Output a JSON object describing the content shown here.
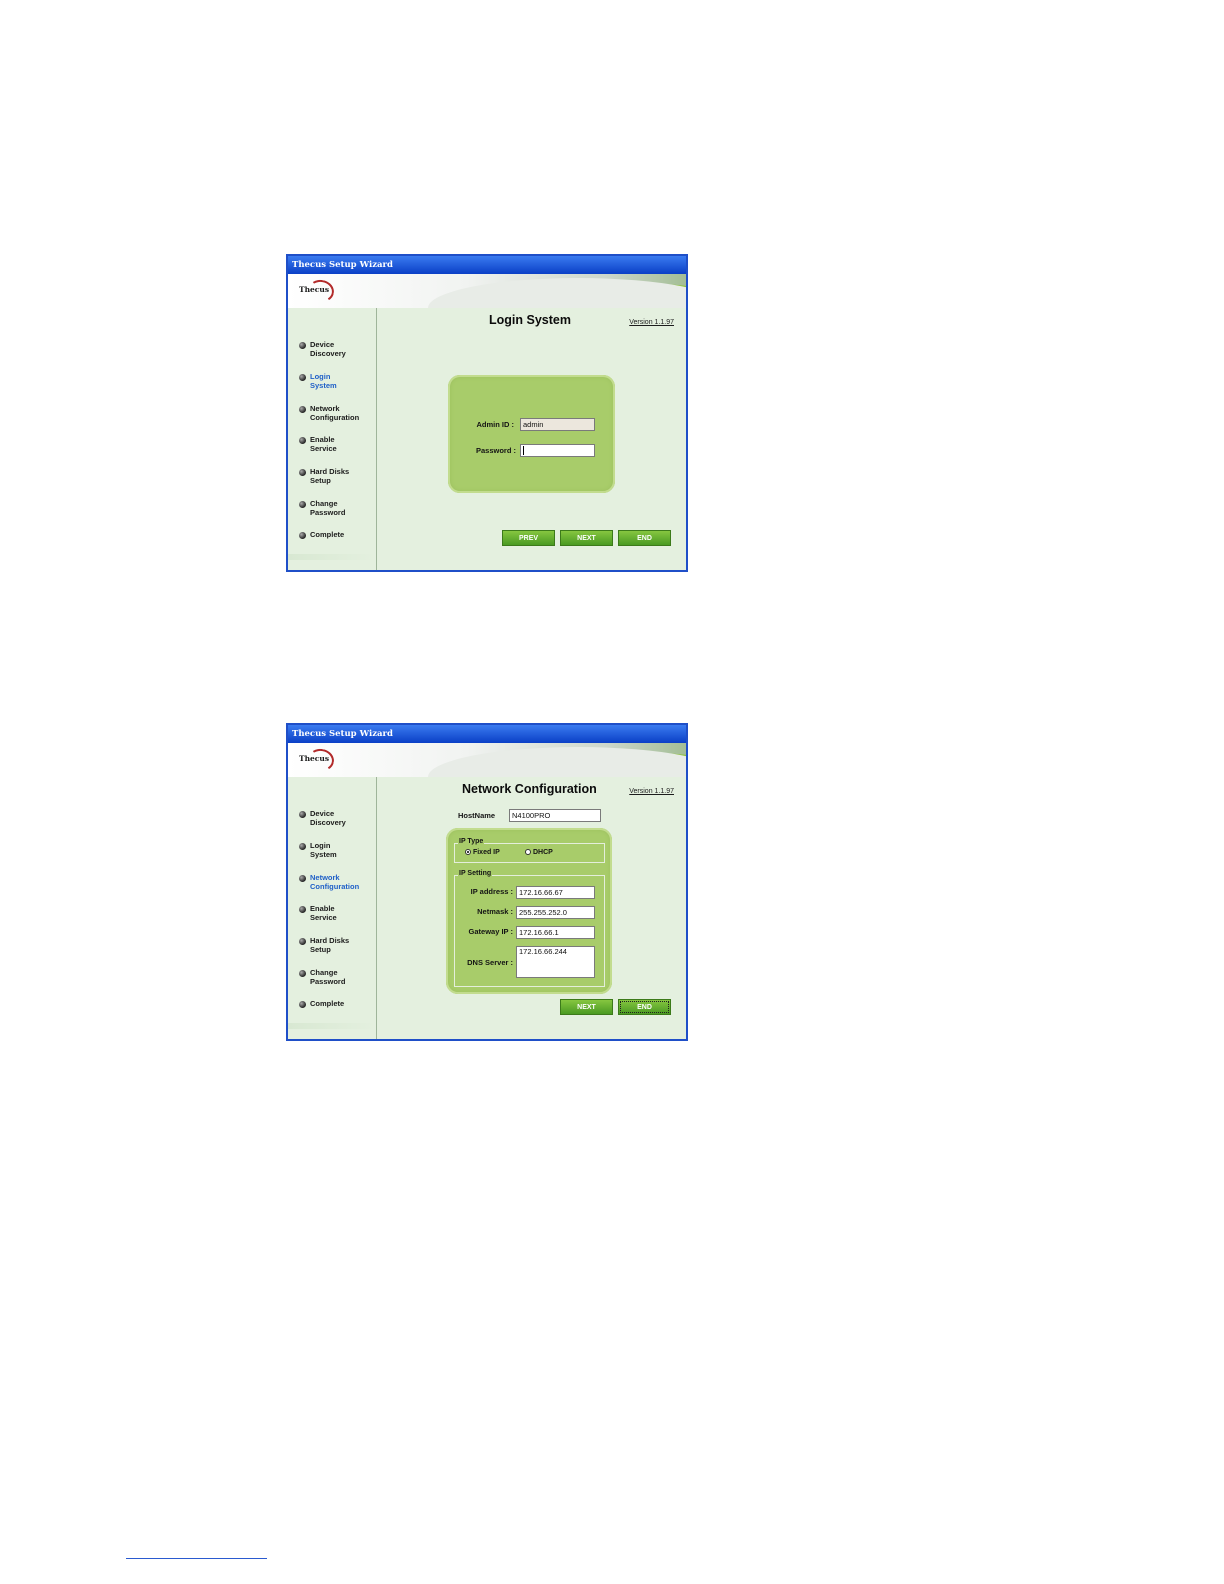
{
  "window_title": "Thecus Setup Wizard",
  "logo_text": "Thecus",
  "version": "Version 1.1.97",
  "nav": [
    {
      "label": "Device\nDiscovery"
    },
    {
      "label": "Login\nSystem"
    },
    {
      "label": "Network\nConfiguration"
    },
    {
      "label": "Enable\nService"
    },
    {
      "label": "Hard Disks\nSetup"
    },
    {
      "label": "Change\nPassword"
    },
    {
      "label": "Complete"
    }
  ],
  "login": {
    "title": "Login System",
    "active_nav": "Login System",
    "admin_label": "Admin ID :",
    "admin_value": "admin",
    "password_label": "Password :",
    "password_value": "",
    "prev": "PREV",
    "next": "NEXT",
    "end": "END"
  },
  "network": {
    "title": "Network Configuration",
    "active_nav": "Network Configuration",
    "hostname_label": "HostName",
    "hostname_value": "N4100PRO",
    "ip_type_legend": "IP Type",
    "fixed_ip": "Fixed IP",
    "dhcp": "DHCP",
    "selected_ip_type": "Fixed IP",
    "ip_setting_legend": "IP Setting",
    "ip_address_label": "IP address :",
    "ip_address_value": "172.16.66.67",
    "netmask_label": "Netmask :",
    "netmask_value": "255.255.252.0",
    "gateway_label": "Gateway IP :",
    "gateway_value": "172.16.66.1",
    "dns_label": "DNS Server :",
    "dns_value": "172.16.66.244",
    "next": "NEXT",
    "end": "END"
  }
}
